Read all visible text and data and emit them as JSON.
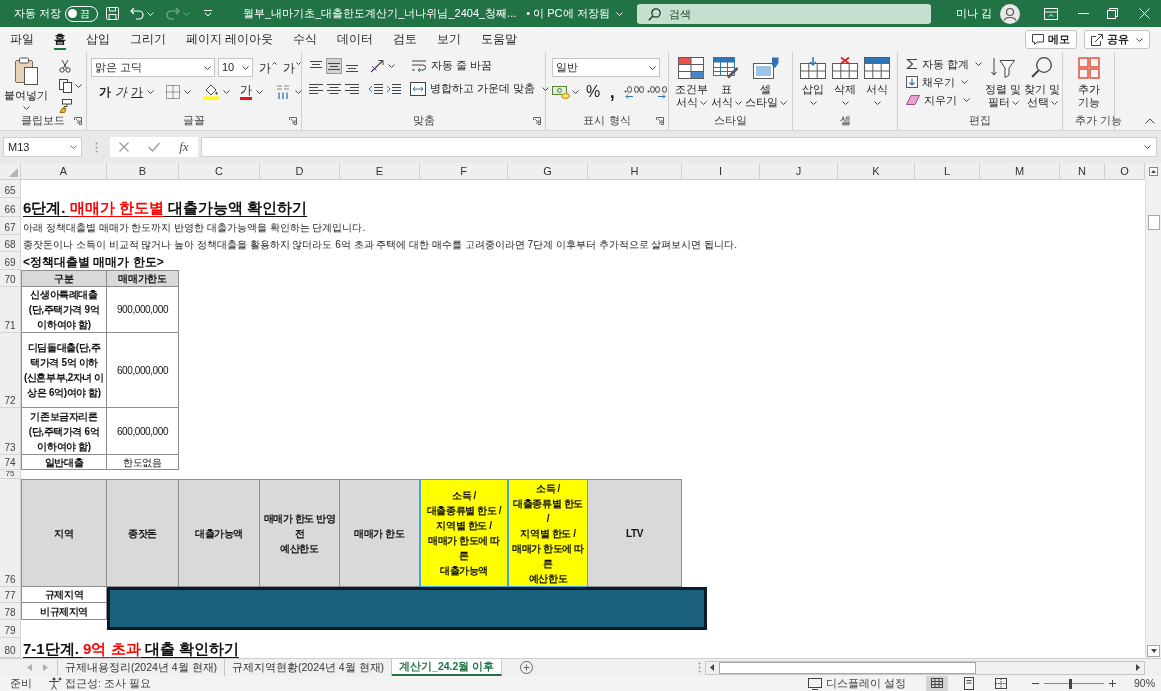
{
  "title_bar": {
    "autosave_label": "자동 저장",
    "autosave": {
      "on": false,
      "label": "끔"
    },
    "document_title": "월부_내마기초_대출한도계산기_너나위님_2404_청째...",
    "save_status": "• 이 PC에 저장됨",
    "search_placeholder": "검색",
    "user_name": "미나 김"
  },
  "menu_tabs": [
    {
      "label": "파일",
      "selected": false
    },
    {
      "label": "홈",
      "selected": true
    },
    {
      "label": "삽입",
      "selected": false
    },
    {
      "label": "그리기",
      "selected": false
    },
    {
      "label": "페이지 레이아웃",
      "selected": false
    },
    {
      "label": "수식",
      "selected": false
    },
    {
      "label": "데이터",
      "selected": false
    },
    {
      "label": "검토",
      "selected": false
    },
    {
      "label": "보기",
      "selected": false
    },
    {
      "label": "도움말",
      "selected": false
    }
  ],
  "header_buttons": [
    {
      "kind": "comment",
      "label": "메모"
    },
    {
      "kind": "share",
      "label": "공유"
    }
  ],
  "ribbon": {
    "groups": [
      {
        "kind": "clipboard",
        "label": "클립보드",
        "launcher": true,
        "paste_label": "붙여넣기"
      },
      {
        "kind": "font",
        "label": "글꼴",
        "launcher": true,
        "font_name": "맑은 고딕",
        "font_size": "10",
        "size_buttons": [
          {
            "kind": "grow",
            "label": "가"
          },
          {
            "kind": "shrink",
            "label": "가"
          }
        ],
        "format_buttons": [
          {
            "kind": "bold",
            "label": "가"
          },
          {
            "kind": "italic",
            "label": "가"
          },
          {
            "kind": "underline",
            "label": "가"
          }
        ],
        "font_color_label": "가"
      },
      {
        "kind": "alignment",
        "label": "맞춤",
        "launcher": true,
        "vertical_alignment": [
          {
            "selected": false
          },
          {
            "selected": true
          },
          {
            "selected": false
          }
        ],
        "wrap_label": "자동 줄 바꿈",
        "merge_label": "병합하고 가운데 맞춤"
      },
      {
        "kind": "number",
        "label": "표시 형식",
        "launcher": true,
        "format": "일반",
        "percent_label": "%",
        "comma_label": ","
      },
      {
        "kind": "styles",
        "label": "스타일",
        "launcher": false,
        "buttons": [
          {
            "kind": "conditional",
            "label": "조건부\n서식"
          },
          {
            "kind": "table",
            "label": "표\n서식"
          },
          {
            "kind": "cell",
            "label": "셀\n스타일"
          }
        ]
      },
      {
        "kind": "cells",
        "label": "셀",
        "launcher": false,
        "buttons": [
          {
            "kind": "insert",
            "label": "삽입"
          },
          {
            "kind": "delete",
            "label": "삭제"
          },
          {
            "kind": "format",
            "label": "서식"
          }
        ]
      },
      {
        "kind": "editing",
        "label": "편집",
        "launcher": false,
        "small_buttons": [
          {
            "kind": "sum",
            "label": "자동 합계"
          },
          {
            "kind": "fill",
            "label": "채우기"
          },
          {
            "kind": "clear",
            "label": "지우기"
          }
        ],
        "buttons": [
          {
            "kind": "sort",
            "label": "정렬 및\n필터"
          },
          {
            "kind": "find",
            "label": "찾기 및\n선택"
          }
        ]
      },
      {
        "kind": "addins",
        "label": "추가 기능",
        "launcher": false,
        "buttons": [
          {
            "kind": "addins",
            "label": "추가\n기능"
          }
        ]
      }
    ]
  },
  "formula_bar": {
    "name_box": "M13",
    "function_label": "fx"
  },
  "sheet": {
    "columns": [
      "A",
      "B",
      "C",
      "D",
      "E",
      "F",
      "G",
      "H",
      "I",
      "J",
      "K",
      "L",
      "M",
      "N",
      "O"
    ],
    "rows": [
      {
        "number": "65"
      },
      {
        "number": "66",
        "cells": [
          {
            "kind": "heading",
            "parts": [
              {
                "text": "6단계. ",
                "highlight": false
              },
              {
                "text": "매매가 한도별",
                "highlight": true
              },
              {
                "text": " 대출가능액 확인하기",
                "highlight": false
              }
            ]
          }
        ]
      },
      {
        "number": "67",
        "cells": [
          {
            "kind": "note",
            "text": "아래 정책대출별 매매가 한도까지 반영한 대출가능액을 확인하는 단계입니다."
          }
        ]
      },
      {
        "number": "68",
        "cells": [
          {
            "kind": "note",
            "text": "종잣돈이나 소득이 비교적 많거나 높아 정책대출을 활용하지 않더라도 6억 초과 주택에 대한 매수를 고려중이라면 7단계 이후부터 추가적으로 살펴보시면 됩니다."
          }
        ]
      },
      {
        "number": "69",
        "cells": [
          {
            "kind": "subheading",
            "text": "<정책대출별 매매가 한도>"
          }
        ]
      },
      {
        "number": "70",
        "cells": [
          {
            "kind": "header",
            "text": "구분"
          },
          {
            "kind": "header",
            "text": "매매가한도"
          }
        ]
      },
      {
        "number": "71",
        "cells": [
          {
            "kind": "label",
            "text": "신생아특례대출\n(단,주택가격 9억\n이하여야 함)"
          },
          {
            "kind": "value",
            "text": "900,000,000"
          }
        ]
      },
      {
        "number": "72",
        "cells": [
          {
            "kind": "label",
            "text": "디딤돌대출(단,주\n택가격 5억 이하\n(신혼부부,2자녀 이\n상은 6억)여야 함)"
          },
          {
            "kind": "value",
            "text": "600,000,000"
          }
        ]
      },
      {
        "number": "73",
        "cells": [
          {
            "kind": "label",
            "text": "기존보금자리론\n(단,주택가격 6억\n이하여야 함)"
          },
          {
            "kind": "value",
            "text": "600,000,000"
          }
        ]
      },
      {
        "number": "74",
        "cells": [
          {
            "kind": "label",
            "text": "일반대출"
          },
          {
            "kind": "value",
            "text": "한도없음"
          }
        ]
      },
      {
        "number": "75"
      },
      {
        "number": "76",
        "cells": [
          {
            "kind": "header",
            "text": "지역"
          },
          {
            "kind": "header",
            "text": "종잣돈"
          },
          {
            "kind": "header",
            "text": "대출가능액"
          },
          {
            "kind": "header",
            "text": "매매가 한도 반영\n전\n예산한도"
          },
          {
            "kind": "header",
            "text": "매매가 한도"
          },
          {
            "kind": "highlight",
            "text": "소득 /\n대출종류별 한도 /\n지역별 한도 /\n매매가 한도에 따\n른\n대출가능액"
          },
          {
            "kind": "highlight",
            "text": "소득 /\n대출종류별 한도\n/\n지역별 한도 /\n매매가 한도에 따\n른\n예산한도"
          },
          {
            "kind": "header",
            "text": "LTV"
          }
        ]
      },
      {
        "number": "77",
        "cells": [
          {
            "kind": "label",
            "text": "규제지역"
          }
        ]
      },
      {
        "number": "78",
        "cells": [
          {
            "kind": "label",
            "text": "비규제지역"
          }
        ]
      },
      {
        "number": "79"
      },
      {
        "number": "80",
        "cells": [
          {
            "kind": "heading",
            "parts": [
              {
                "text": "7-1단계. ",
                "highlight": false
              },
              {
                "text": "9억 초과",
                "highlight": true
              },
              {
                "text": " 대출 확인하기",
                "highlight": false
              }
            ]
          }
        ]
      }
    ],
    "shapes": [
      {
        "kind": "rectangle"
      }
    ]
  },
  "sheet_tabs": [
    {
      "label": "규제내용정리(2024년 4월 현재)",
      "selected": false
    },
    {
      "label": "규제지역현황(2024년 4월 현재)",
      "selected": false
    },
    {
      "label": "계산기_24.2월 이후",
      "selected": true
    }
  ],
  "status_bar": {
    "mode": "준비",
    "accessibility": "접근성: 조사 필요",
    "display_settings": "디스플레이 설정",
    "views": [
      {
        "kind": "normal",
        "selected": true
      },
      {
        "kind": "page_layout",
        "selected": false
      },
      {
        "kind": "page_break",
        "selected": false
      }
    ],
    "zoom": {
      "level": 0.45,
      "label": "90%"
    }
  }
}
